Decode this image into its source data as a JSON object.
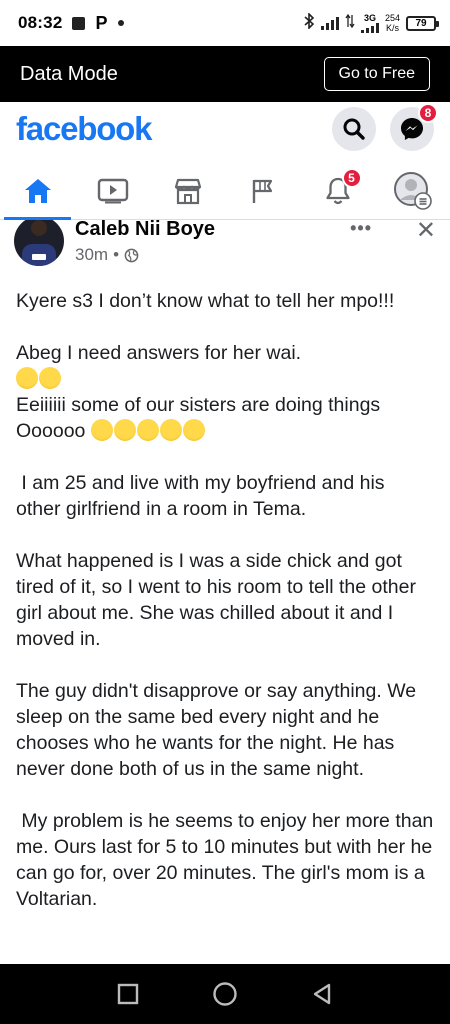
{
  "status_bar": {
    "time": "08:32",
    "p_label": "P",
    "network_type": "3G",
    "speed_value": "254",
    "speed_unit": "K/s",
    "battery": "79"
  },
  "data_mode": {
    "title": "Data Mode",
    "go_free_label": "Go to Free"
  },
  "header": {
    "logo": "facebook",
    "messenger_badge": "8",
    "accent_color": "#1877f2"
  },
  "nav": {
    "tabs": [
      {
        "icon": "home-icon",
        "active": true
      },
      {
        "icon": "watch-icon",
        "active": false
      },
      {
        "icon": "marketplace-icon",
        "active": false
      },
      {
        "icon": "pages-flag-icon",
        "active": false
      },
      {
        "icon": "notifications-bell-icon",
        "active": false,
        "badge": "5"
      },
      {
        "icon": "profile-menu-icon",
        "active": false
      }
    ]
  },
  "post": {
    "author": "Caleb Nii Boye",
    "time": "30m",
    "separator": "•",
    "menu": "•••",
    "close": "✕",
    "paragraphs": {
      "p1": "Kyere s3 I don’t know what to tell her mpo!!!",
      "p2": "Abeg I need answers for her wai.",
      "p3": "Eeiiiiii some of our sisters are doing things Oooooo",
      "p4": " I am 25 and live with my boyfriend and his other girlfriend in a room in Tema.",
      "p5": "What happened is I was a side chick and got tired of it, so I went to his room to tell the other girl about me. She was chilled about it and I moved in.",
      "p6": "The guy didn't disapprove or say anything. We sleep on the same bed every night and he chooses who he wants for the night. He has never done both of us in the same night.",
      "p7": " My problem is he seems to enjoy her more than me. Ours last for 5 to 10 minutes but with her he can go for, over 20 minutes. The girl's mom is a Voltarian."
    }
  }
}
